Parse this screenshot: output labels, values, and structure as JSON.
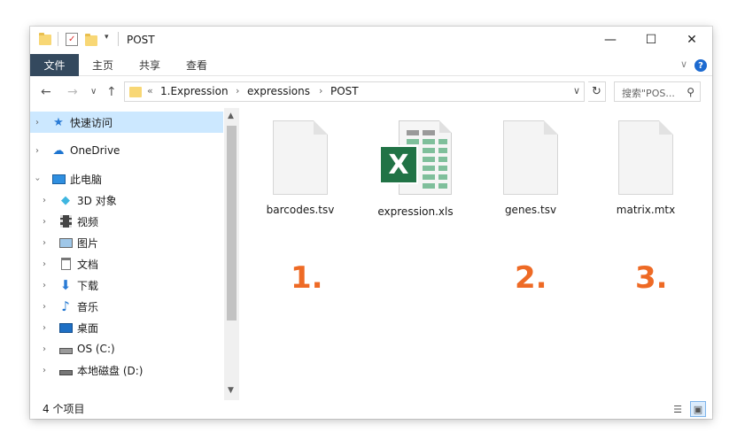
{
  "window": {
    "title": "POST",
    "minimize": "—",
    "maximize": "☐",
    "close": "✕"
  },
  "ribbon": {
    "file_tab": "文件",
    "tabs": [
      "主页",
      "共享",
      "查看"
    ],
    "help": "?",
    "collapse": "∨"
  },
  "address_bar": {
    "back": "←",
    "forward": "→",
    "recent": "∨",
    "up": "↑",
    "overflow": "«",
    "breadcrumbs": [
      "1.Expression",
      "expressions",
      "POST"
    ],
    "separator": "›",
    "dropdown": "∨",
    "refresh": "↻"
  },
  "search": {
    "placeholder": "搜索\"POS...",
    "icon": "search-icon"
  },
  "nav_pane": {
    "items": [
      {
        "label": "快速访问",
        "icon": "star-icon",
        "selected": true
      },
      {
        "label": "OneDrive",
        "icon": "cloud-icon"
      },
      {
        "label": "此电脑",
        "icon": "computer-icon",
        "expanded": true
      },
      {
        "label": "3D 对象",
        "icon": "cube-icon"
      },
      {
        "label": "视频",
        "icon": "film-icon"
      },
      {
        "label": "图片",
        "icon": "picture-icon"
      },
      {
        "label": "文档",
        "icon": "document-icon"
      },
      {
        "label": "下载",
        "icon": "download-icon"
      },
      {
        "label": "音乐",
        "icon": "music-icon"
      },
      {
        "label": "桌面",
        "icon": "desktop-icon"
      },
      {
        "label": "OS (C:)",
        "icon": "windows-drive-icon"
      },
      {
        "label": "本地磁盘 (D:)",
        "icon": "drive-icon"
      }
    ]
  },
  "files": [
    {
      "name": "barcodes.tsv",
      "type": "blank-file-icon",
      "marker": "1."
    },
    {
      "name": "expression.xls",
      "type": "excel-file-icon",
      "marker": ""
    },
    {
      "name": "genes.tsv",
      "type": "blank-file-icon",
      "marker": "2."
    },
    {
      "name": "matrix.mtx",
      "type": "blank-file-icon",
      "marker": "3."
    }
  ],
  "colors": {
    "marker": "#ee6a25",
    "excel": "#217346",
    "selection": "#cce8ff",
    "file_tab": "#34495e"
  },
  "status_bar": {
    "item_count": "4 个项目"
  }
}
